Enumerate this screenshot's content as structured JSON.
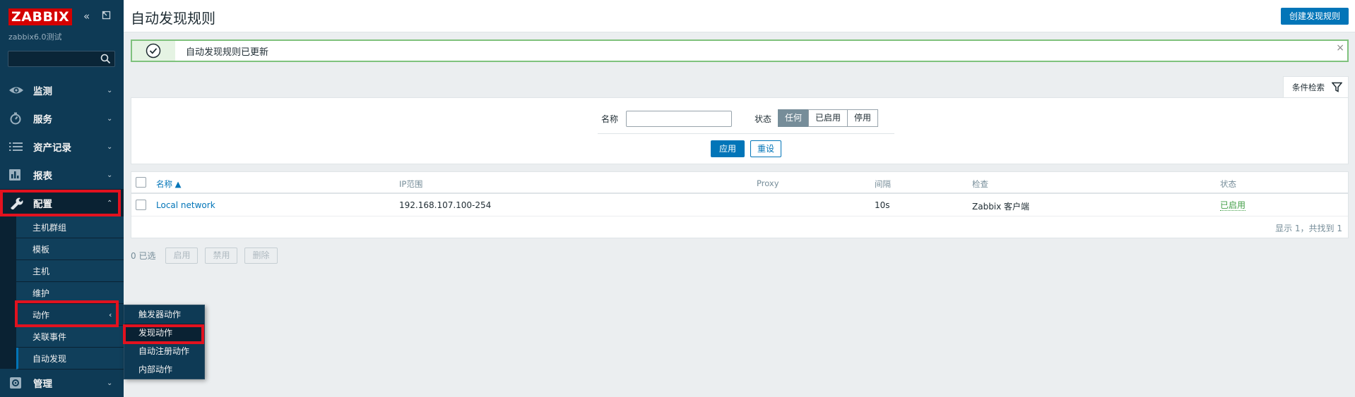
{
  "app": {
    "logo": "ZABBIX",
    "server_name": "zabbix6.0测试",
    "search": {
      "value": "",
      "placeholder": ""
    }
  },
  "sidebar": {
    "items": [
      {
        "label": "监测",
        "icon": "eye-icon"
      },
      {
        "label": "服务",
        "icon": "stopwatch-icon"
      },
      {
        "label": "资产记录",
        "icon": "list-icon"
      },
      {
        "label": "报表",
        "icon": "bar-chart-icon"
      },
      {
        "label": "配置",
        "icon": "wrench-icon"
      },
      {
        "label": "管理",
        "icon": "cog-icon"
      }
    ],
    "config_submenu": [
      "主机群组",
      "模板",
      "主机",
      "维护",
      "动作",
      "关联事件",
      "自动发现"
    ],
    "actions_flyout": [
      "触发器动作",
      "发现动作",
      "自动注册动作",
      "内部动作"
    ]
  },
  "header": {
    "title": "自动发现规则",
    "create_button": "创建发现规则"
  },
  "message": {
    "text": "自动发现规则已更新",
    "close": "×"
  },
  "filter": {
    "tab_label": "条件检索",
    "name_label": "名称",
    "name_value": "",
    "status_label": "状态",
    "status_options": [
      "任何",
      "已启用",
      "停用"
    ],
    "status_selected": "任何",
    "apply": "应用",
    "reset": "重设"
  },
  "table": {
    "columns": [
      "名称 ▲",
      "IP范围",
      "Proxy",
      "间隔",
      "检查",
      "状态"
    ],
    "rows": [
      {
        "name": "Local network",
        "ip_range": "192.168.107.100-254",
        "proxy": "",
        "interval": "10s",
        "checks": "Zabbix 客户端",
        "status": "已启用"
      }
    ],
    "footer": "显示 1，共找到 1"
  },
  "mass_actions": {
    "selected": "0 已选",
    "buttons": [
      "启用",
      "禁用",
      "删除"
    ]
  },
  "colors": {
    "sidebar_bg": "#0e3a55",
    "accent": "#0275b8",
    "success": "#429e47",
    "highlight_box": "#e2121f",
    "logo_red": "#d40000"
  }
}
